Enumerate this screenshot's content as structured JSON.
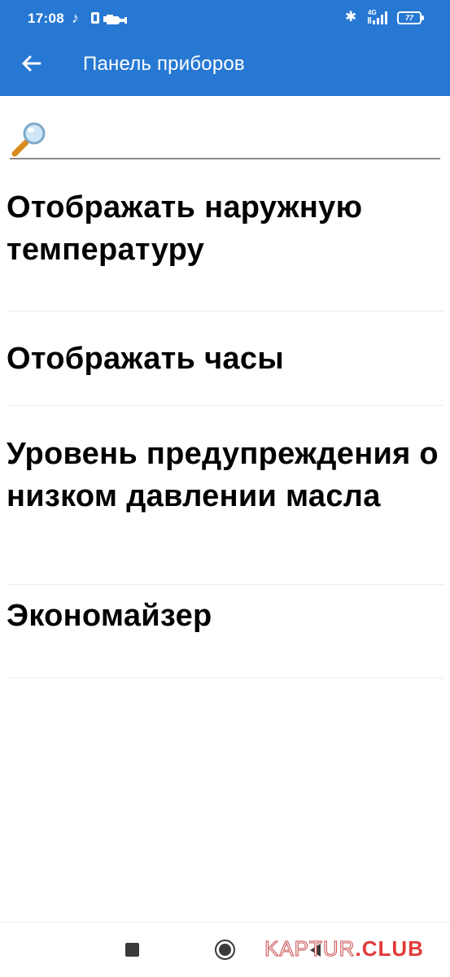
{
  "status_bar": {
    "time": "17:08",
    "network": "4G",
    "battery": "77"
  },
  "app_bar": {
    "title": "Панель приборов",
    "back_icon": "arrow-left-icon"
  },
  "search": {
    "icon": "magnifier-icon",
    "value": "",
    "placeholder": ""
  },
  "settings": [
    {
      "label": "Отображать наружную температуру"
    },
    {
      "label": "Отображать часы"
    },
    {
      "label": "Уровень предупреждения о низком давлении масла"
    },
    {
      "label": "Экономайзер"
    }
  ],
  "navbar": {
    "recents_icon": "square-icon",
    "home_icon": "circle-icon",
    "back_icon": "triangle-back-icon"
  },
  "watermark": {
    "part1": "KAPTUR",
    "part2": ".CLUB"
  },
  "colors": {
    "app_bar": "#2778d3",
    "watermark": "#e23a3a",
    "text": "#000000"
  }
}
